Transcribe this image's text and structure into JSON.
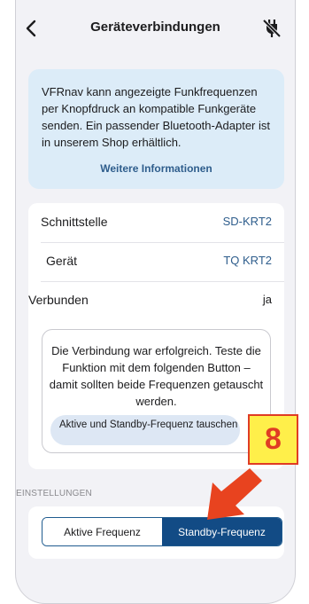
{
  "nav": {
    "title": "Geräteverbindungen",
    "back_icon": "chevron-left-icon",
    "plug_icon": "plug-disconnect-icon"
  },
  "info": {
    "text": "VFRnav kann angezeigte Funkfrequenzen per Knopfdruck an kompatible Funkgeräte senden. Ein passender Bluetooth-Adapter ist in unserem Shop erhältlich.",
    "link": "Weitere Informationen"
  },
  "rows": [
    {
      "label": "Schnittstelle",
      "value": "SD-KRT2"
    },
    {
      "label": "Gerät",
      "value": "TQ KRT2"
    },
    {
      "label": "Verbunden",
      "value": "ja"
    }
  ],
  "success": {
    "text": "Die Verbindung war erfolgreich. Teste die Funktion mit dem folgenden Button – damit sollten beide Frequenzen getauscht werden.",
    "button": "Aktive und Standby-Frequenz tauschen"
  },
  "settings": {
    "header": "EINSTELLUNGEN",
    "segments": [
      "Aktive Frequenz",
      "Standby-Frequenz"
    ],
    "selected": "Standby-Frequenz"
  },
  "annotation": {
    "badge": "8",
    "colors": {
      "badge_fill": "#ffef4a",
      "accent": "#e03c24"
    }
  },
  "colors": {
    "accent_blue": "#2e5d8c",
    "segment_active": "#124b85",
    "info_bg": "#dcecf8"
  }
}
